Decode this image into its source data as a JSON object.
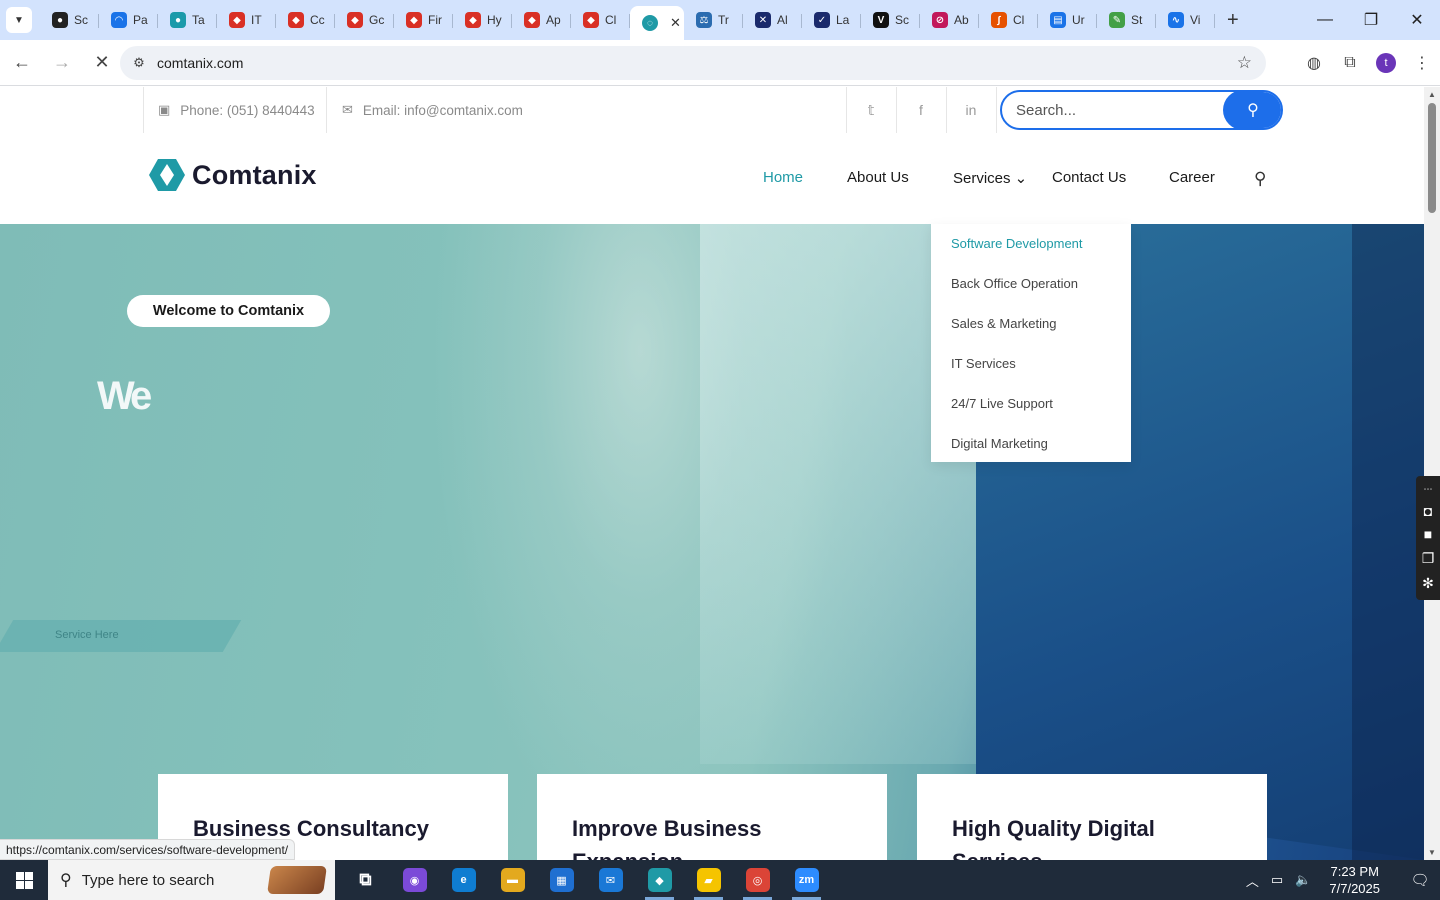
{
  "browser": {
    "tabs": [
      {
        "label": "Sc",
        "color": "#222222",
        "glyph": "●"
      },
      {
        "label": "Pa",
        "color": "#1a73e8",
        "glyph": "◠"
      },
      {
        "label": "Ta",
        "color": "#1b9aaa",
        "glyph": "●"
      },
      {
        "label": "IT",
        "color": "#d93025",
        "glyph": "◆"
      },
      {
        "label": "Cc",
        "color": "#d93025",
        "glyph": "◆"
      },
      {
        "label": "Gc",
        "color": "#d93025",
        "glyph": "◆"
      },
      {
        "label": "Fir",
        "color": "#d93025",
        "glyph": "◆"
      },
      {
        "label": "Hy",
        "color": "#d93025",
        "glyph": "◆"
      },
      {
        "label": "Ap",
        "color": "#d93025",
        "glyph": "◆"
      },
      {
        "label": "Cl",
        "color": "#d93025",
        "glyph": "◆"
      }
    ],
    "active_tab": {
      "color": "#1f9aa6",
      "close_glyph": "✕"
    },
    "tabs_after": [
      {
        "label": "Tr",
        "color": "#2b6cb0",
        "glyph": "⚖"
      },
      {
        "label": "Al",
        "color": "#1a2a6c",
        "glyph": "✕"
      },
      {
        "label": "La",
        "color": "#1a2a6c",
        "glyph": "✓"
      },
      {
        "label": "Sc",
        "color": "#111111",
        "glyph": "V"
      },
      {
        "label": "Ab",
        "color": "#c2185b",
        "glyph": "⊘"
      },
      {
        "label": "Cl",
        "color": "#e65100",
        "glyph": "∫"
      },
      {
        "label": "Ur",
        "color": "#1a73e8",
        "glyph": "▤"
      },
      {
        "label": "St",
        "color": "#43a047",
        "glyph": "✎"
      },
      {
        "label": "Vi",
        "color": "#1a73e8",
        "glyph": "∿"
      }
    ],
    "new_tab_glyph": "+",
    "window_controls": [
      "—",
      "❐",
      "✕"
    ],
    "url": "comtanix.com",
    "profile_initial": "t",
    "status_url": "https://comtanix.com/services/software-development/"
  },
  "site": {
    "topbar": {
      "phone": "Phone: (051) 8440443",
      "email": "Email: info@comtanix.com",
      "social": [
        "𝕥",
        "f",
        "in"
      ],
      "search_placeholder": "Search..."
    },
    "brand": "Comtanix",
    "nav": [
      {
        "label": "Home",
        "active": true
      },
      {
        "label": "About Us"
      },
      {
        "label": "Services ⌄"
      },
      {
        "label": "Contact Us"
      },
      {
        "label": "Career"
      }
    ],
    "dropdown": [
      "Software Development",
      "Back Office Operation",
      "Sales & Marketing",
      "IT Services",
      "24/7 Live Support",
      "Digital Marketing"
    ],
    "hero": {
      "badge": "Welcome to Comtanix",
      "animated_text": "We",
      "service_label": "Service Here"
    },
    "cards": [
      {
        "title": "Business Consultancy"
      },
      {
        "title": "Improve Business Expansion"
      },
      {
        "title": "High Quality Digital Services"
      }
    ]
  },
  "taskbar": {
    "search_placeholder": "Type here to search",
    "apps": [
      {
        "name": "task-view",
        "glyph": "⧉",
        "color": "transparent"
      },
      {
        "name": "copilot",
        "glyph": "◉",
        "color": "#7b4ad8"
      },
      {
        "name": "edge",
        "glyph": "e",
        "color": "#0f7dd1"
      },
      {
        "name": "file-explorer",
        "glyph": "▬",
        "color": "#e3a91e"
      },
      {
        "name": "store",
        "glyph": "▦",
        "color": "#1f6fd1"
      },
      {
        "name": "mail",
        "glyph": "✉",
        "color": "#1a78d6"
      },
      {
        "name": "comtanix-app",
        "glyph": "◆",
        "color": "#1f9aa6",
        "open": true
      },
      {
        "name": "sticky-notes",
        "glyph": "▰",
        "color": "#f5c400",
        "open": true
      },
      {
        "name": "chrome",
        "glyph": "◎",
        "color": "#db4437",
        "open": true
      },
      {
        "name": "zoom",
        "glyph": "zm",
        "color": "#2d8cff",
        "open": true
      }
    ],
    "time": "7:23 PM",
    "date": "7/7/2025"
  }
}
